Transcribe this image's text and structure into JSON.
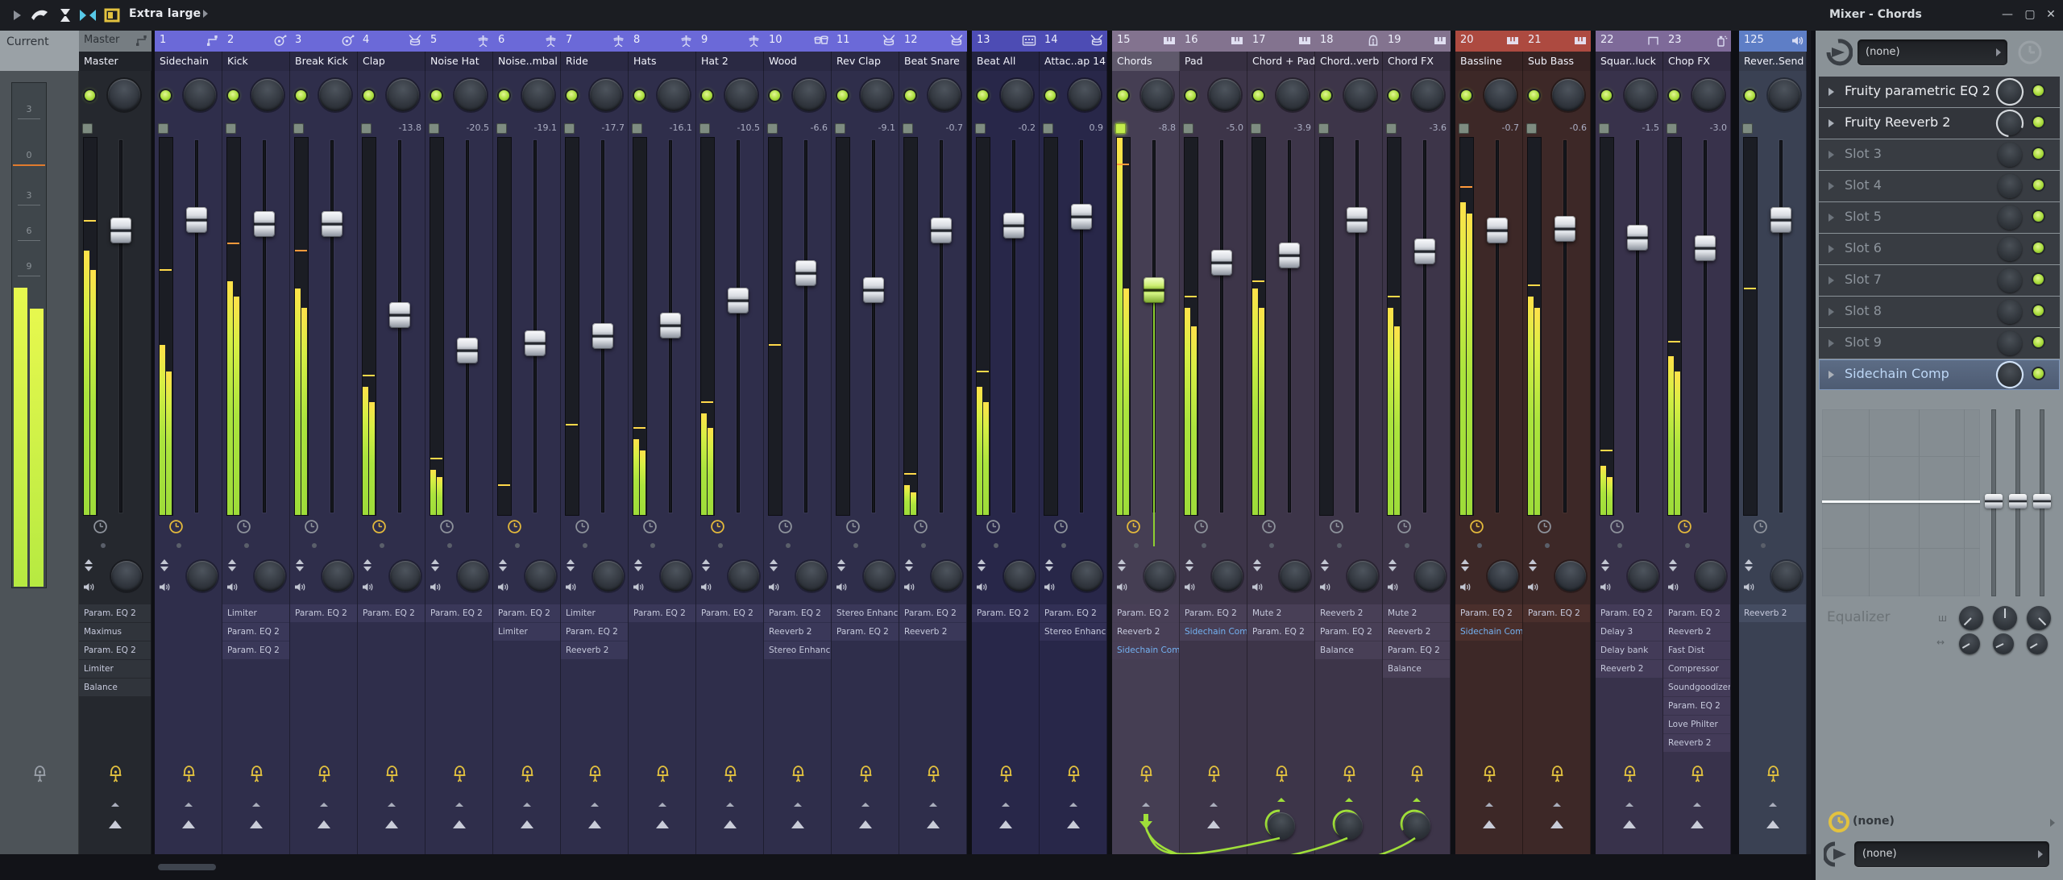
{
  "window": {
    "title": "Mixer - Chords",
    "controls": [
      {
        "glyph": "—",
        "name": "minimize"
      },
      {
        "glyph": "▢",
        "name": "maximize"
      },
      {
        "glyph": "✕",
        "name": "close"
      }
    ]
  },
  "toolbar": {
    "layout_label": "Extra large",
    "icons": [
      "play-icon",
      "detached-icon",
      "autoscroll-icon",
      "focus-icon",
      "layout-color-icon"
    ]
  },
  "groups": {
    "a": {
      "header": "#6b69d8",
      "body": "#2f2e4b",
      "row": "#3a3859"
    },
    "b": {
      "header": "#4d4cb4",
      "body": "#282749",
      "row": "#323055"
    },
    "c": {
      "header": "#83738f",
      "body": "#3d3549",
      "row": "#483f56"
    },
    "d": {
      "header": "#ad4a40",
      "body": "#3d2827",
      "row": "#4a2f2c"
    },
    "e": {
      "header": "#7e6a99",
      "body": "#38324b",
      "row": "#433b58"
    },
    "f": {
      "header": "#5e7ec6",
      "body": "#3a4153",
      "row": "#454d62"
    },
    "m": {
      "header": "#767d82",
      "body": "#25282e",
      "row": "#30343b"
    }
  },
  "status_colors": {
    "meter_green": "#abe43d",
    "peak_yellow": "#ffd94a",
    "peak_orange": "#ff9a3c",
    "select_green": "#9fdf3a",
    "clock_yellow": "#e3b93c",
    "clock_gray": "#8e939c"
  },
  "current": {
    "label": "Current",
    "scale": [
      {
        "t": "3",
        "p": 5
      },
      {
        "t": "0",
        "p": 14,
        "accent": true
      },
      {
        "t": "3",
        "p": 22
      },
      {
        "t": "6",
        "p": 29
      },
      {
        "t": "9",
        "p": 36
      }
    ],
    "meter": {
      "l": 0.59,
      "r": 0.55
    }
  },
  "master": {
    "tab": "Master",
    "name": "Master",
    "db": "",
    "fader": 0.23,
    "meter": {
      "l": 0.7,
      "r": 0.65,
      "peak": 0.78,
      "peakc": "y"
    },
    "plugins": [
      {
        "n": "Param. EQ 2"
      },
      {
        "n": "Maximus"
      },
      {
        "n": "Param. EQ 2"
      },
      {
        "n": "Limiter"
      },
      {
        "n": "Balance"
      }
    ]
  },
  "tracks": [
    {
      "num": "1",
      "name": "Sidechain",
      "icon": "routing-icon",
      "group": "a",
      "gap": 4,
      "db": "",
      "fader": 0.2,
      "meter": {
        "l": 0.45,
        "r": 0.38,
        "peak": 0.65,
        "peakc": "y"
      },
      "clock": "y",
      "plugins": []
    },
    {
      "num": "2",
      "name": "Kick",
      "icon": "kick-drum-icon",
      "group": "a",
      "gap": 0,
      "db": "",
      "fader": 0.21,
      "meter": {
        "l": 0.62,
        "r": 0.58,
        "peak": 0.72,
        "peakc": "o"
      },
      "clock": "g",
      "plugins": [
        {
          "n": "Limiter"
        },
        {
          "n": "Param. EQ 2"
        },
        {
          "n": "Param. EQ 2"
        }
      ]
    },
    {
      "num": "3",
      "name": "Break Kick",
      "icon": "kick-drum-icon",
      "group": "a",
      "gap": 0,
      "db": "",
      "fader": 0.21,
      "meter": {
        "l": 0.6,
        "r": 0.55,
        "peak": 0.7,
        "peakc": "o"
      },
      "clock": "g",
      "plugins": [
        {
          "n": "Param. EQ 2"
        }
      ]
    },
    {
      "num": "4",
      "name": "Clap",
      "icon": "snare-drum-icon",
      "group": "a",
      "gap": 0,
      "db": "-13.8",
      "fader": 0.47,
      "meter": {
        "l": 0.34,
        "r": 0.3,
        "peak": 0.37,
        "peakc": "y"
      },
      "clock": "y",
      "plugins": [
        {
          "n": "Param. EQ 2"
        }
      ]
    },
    {
      "num": "5",
      "name": "Noise Hat",
      "icon": "hihat-icon",
      "group": "a",
      "gap": 0,
      "db": "-20.5",
      "fader": 0.57,
      "meter": {
        "l": 0.12,
        "r": 0.1,
        "peak": 0.15,
        "peakc": "y"
      },
      "clock": "g",
      "plugins": [
        {
          "n": "Param. EQ 2"
        }
      ]
    },
    {
      "num": "6",
      "name": "Noise..mbal",
      "icon": "hihat-icon",
      "group": "a",
      "gap": 0,
      "db": "-19.1",
      "fader": 0.55,
      "meter": {
        "l": 0,
        "r": 0,
        "peak": 0.08,
        "peakc": "y"
      },
      "clock": "y",
      "plugins": [
        {
          "n": "Param. EQ 2"
        },
        {
          "n": "Limiter"
        }
      ]
    },
    {
      "num": "7",
      "name": "Ride",
      "icon": "hihat-icon",
      "group": "a",
      "gap": 0,
      "db": "-17.7",
      "fader": 0.53,
      "meter": {
        "l": 0,
        "r": 0,
        "peak": 0.24,
        "peakc": "y"
      },
      "clock": "g",
      "plugins": [
        {
          "n": "Limiter"
        },
        {
          "n": "Param. EQ 2"
        },
        {
          "n": "Reeverb 2"
        }
      ]
    },
    {
      "num": "8",
      "name": "Hats",
      "icon": "hihat-icon",
      "group": "a",
      "gap": 0,
      "db": "-16.1",
      "fader": 0.5,
      "meter": {
        "l": 0.2,
        "r": 0.17,
        "peak": 0.23,
        "peakc": "y"
      },
      "clock": "g",
      "plugins": [
        {
          "n": "Param. EQ 2"
        }
      ]
    },
    {
      "num": "9",
      "name": "Hat 2",
      "icon": "hihat-icon",
      "group": "a",
      "gap": 0,
      "db": "-10.5",
      "fader": 0.43,
      "meter": {
        "l": 0.27,
        "r": 0.23,
        "peak": 0.3,
        "peakc": "y"
      },
      "clock": "y",
      "plugins": [
        {
          "n": "Param. EQ 2"
        }
      ]
    },
    {
      "num": "10",
      "name": "Wood",
      "icon": "bongo-icon",
      "group": "a",
      "gap": 0,
      "db": "-6.6",
      "fader": 0.35,
      "meter": {
        "l": 0,
        "r": 0,
        "peak": 0.45,
        "peakc": "y"
      },
      "clock": "g",
      "plugins": [
        {
          "n": "Param. EQ 2"
        },
        {
          "n": "Reeverb 2"
        },
        {
          "n": "Stereo Enhancer"
        }
      ]
    },
    {
      "num": "11",
      "name": "Rev Clap",
      "icon": "snare-drum-icon",
      "group": "a",
      "gap": 0,
      "db": "-9.1",
      "fader": 0.4,
      "meter": {
        "l": 0,
        "r": 0,
        "peak": 0,
        "peakc": "y"
      },
      "clock": "g",
      "plugins": [
        {
          "n": "Stereo Enhancer"
        },
        {
          "n": "Param. EQ 2"
        }
      ]
    },
    {
      "num": "12",
      "name": "Beat Snare",
      "icon": "snare-drum-icon",
      "group": "a",
      "gap": 0,
      "db": "-0.7",
      "fader": 0.23,
      "meter": {
        "l": 0.08,
        "r": 0.06,
        "peak": 0.11,
        "peakc": "y"
      },
      "clock": "g",
      "plugins": [
        {
          "n": "Param. EQ 2"
        },
        {
          "n": "Reeverb 2"
        }
      ]
    },
    {
      "num": "13",
      "name": "Beat All",
      "icon": "drum-machine-icon",
      "group": "b",
      "gap": 6,
      "db": "-0.2",
      "fader": 0.215,
      "meter": {
        "l": 0.34,
        "r": 0.3,
        "peak": 0.38,
        "peakc": "y"
      },
      "clock": "g",
      "plugins": [
        {
          "n": "Param. EQ 2"
        }
      ]
    },
    {
      "num": "14",
      "name": "Attac..ap 14",
      "icon": "snare-drum-icon",
      "group": "b",
      "gap": 0,
      "db": "0.9",
      "fader": 0.19,
      "meter": {
        "l": 0,
        "r": 0,
        "peak": 0,
        "peakc": "y"
      },
      "clock": "g",
      "plugins": [
        {
          "n": "Param. EQ 2"
        },
        {
          "n": "Stereo Enhancer"
        }
      ]
    },
    {
      "num": "15",
      "name": "Chords",
      "icon": "piano-icon",
      "group": "c",
      "gap": 6,
      "db": "-8.8",
      "fader": 0.4,
      "meter": {
        "l": 1.0,
        "r": 0.6,
        "peak": 0.93,
        "peakc": "o"
      },
      "clock": "y",
      "selected": true,
      "bottom": "arrow",
      "plugins": [
        {
          "n": "Param. EQ 2"
        },
        {
          "n": "Reeverb 2"
        },
        {
          "n": "Sidechain Comp",
          "hl": true
        }
      ]
    },
    {
      "num": "16",
      "name": "Pad",
      "icon": "piano-icon",
      "group": "c",
      "gap": 0,
      "db": "-5.0",
      "fader": 0.32,
      "meter": {
        "l": 0.55,
        "r": 0.5,
        "peak": 0.58,
        "peakc": "y"
      },
      "clock": "g",
      "plugins": [
        {
          "n": "Param. EQ 2"
        },
        {
          "n": "Sidechain Comp",
          "hl": true
        }
      ]
    },
    {
      "num": "17",
      "name": "Chord + Pad",
      "icon": "piano-icon",
      "group": "c",
      "gap": 0,
      "db": "-3.9",
      "fader": 0.3,
      "meter": {
        "l": 0.6,
        "r": 0.55,
        "peak": 0.62,
        "peakc": "y"
      },
      "clock": "g",
      "bottom": "send",
      "plugins": [
        {
          "n": "Mute 2"
        },
        {
          "n": "Param. EQ 2"
        }
      ]
    },
    {
      "num": "18",
      "name": "Chord..verb",
      "icon": "reverb-icon",
      "group": "c",
      "gap": 0,
      "db": "",
      "fader": 0.2,
      "meter": {
        "l": 0,
        "r": 0,
        "peak": 0,
        "peakc": "y"
      },
      "clock": "g",
      "bottom": "send",
      "plugins": [
        {
          "n": "Reeverb 2"
        },
        {
          "n": "Param. EQ 2"
        },
        {
          "n": "Balance"
        }
      ]
    },
    {
      "num": "19",
      "name": "Chord FX",
      "icon": "piano-icon",
      "group": "c",
      "gap": 0,
      "db": "-3.6",
      "fader": 0.29,
      "meter": {
        "l": 0.55,
        "r": 0.5,
        "peak": 0.58,
        "peakc": "y"
      },
      "clock": "g",
      "bottom": "send",
      "plugins": [
        {
          "n": "Mute 2"
        },
        {
          "n": "Reeverb 2"
        },
        {
          "n": "Param. EQ 2"
        },
        {
          "n": "Balance"
        }
      ]
    },
    {
      "num": "20",
      "name": "Bassline",
      "icon": "piano-icon",
      "group": "d",
      "gap": 6,
      "db": "-0.7",
      "fader": 0.23,
      "meter": {
        "l": 0.83,
        "r": 0.8,
        "peak": 0.87,
        "peakc": "o"
      },
      "clock": "y",
      "plugins": [
        {
          "n": "Param. EQ 2"
        },
        {
          "n": "Sidechain Comp",
          "hl": true
        }
      ]
    },
    {
      "num": "21",
      "name": "Sub Bass",
      "icon": "piano-icon",
      "group": "d",
      "gap": 0,
      "db": "-0.6",
      "fader": 0.225,
      "meter": {
        "l": 0.58,
        "r": 0.55,
        "peak": 0.61,
        "peakc": "y"
      },
      "clock": "g",
      "plugins": [
        {
          "n": "Param. EQ 2"
        }
      ]
    },
    {
      "num": "22",
      "name": "Squar..luck",
      "icon": "square-wave-icon",
      "group": "e",
      "gap": 6,
      "db": "-1.5",
      "fader": 0.25,
      "meter": {
        "l": 0.13,
        "r": 0.1,
        "peak": 0.17,
        "peakc": "y"
      },
      "clock": "g",
      "plugins": [
        {
          "n": "Param. EQ 2"
        },
        {
          "n": "Delay 3"
        },
        {
          "n": "Delay bank"
        },
        {
          "n": "Reeverb 2"
        }
      ]
    },
    {
      "num": "23",
      "name": "Chop FX",
      "icon": "spray-icon",
      "group": "e",
      "gap": 0,
      "db": "-3.0",
      "fader": 0.28,
      "meter": {
        "l": 0.42,
        "r": 0.38,
        "peak": 0.46,
        "peakc": "y"
      },
      "clock": "y",
      "plugins": [
        {
          "n": "Param. EQ 2"
        },
        {
          "n": "Reeverb 2"
        },
        {
          "n": "Fast Dist"
        },
        {
          "n": "Compressor"
        },
        {
          "n": "Soundgoodizer"
        },
        {
          "n": "Param. EQ 2"
        },
        {
          "n": "Love Philter"
        },
        {
          "n": "Reeverb 2"
        }
      ]
    },
    {
      "num": "125",
      "name": "Rever..Send",
      "icon": "speaker-icon",
      "group": "f",
      "gap": 10,
      "db": "",
      "fader": 0.2,
      "meter": {
        "l": 0,
        "r": 0,
        "peak": 0.6,
        "peakc": "y"
      },
      "clock": "g",
      "plugins": [
        {
          "n": "Reeverb 2"
        }
      ]
    }
  ],
  "panel": {
    "input_value": "(none)",
    "slots": [
      {
        "label": "Fruity parametric EQ 2",
        "state": "used",
        "ring": "full"
      },
      {
        "label": "Fruity Reeverb 2",
        "state": "used",
        "ring": "arc"
      },
      {
        "label": "Slot 3",
        "state": "empty"
      },
      {
        "label": "Slot 4",
        "state": "empty"
      },
      {
        "label": "Slot 5",
        "state": "empty"
      },
      {
        "label": "Slot 6",
        "state": "empty"
      },
      {
        "label": "Slot 7",
        "state": "empty"
      },
      {
        "label": "Slot 8",
        "state": "empty"
      },
      {
        "label": "Slot 9",
        "state": "empty"
      },
      {
        "label": "Sidechain Comp",
        "state": "selected",
        "ring": "full-blue"
      }
    ],
    "equalizer_label": "Equalizer",
    "eq_knob_angles": [
      [
        -135,
        0,
        135
      ],
      [
        -120,
        -115,
        -120
      ]
    ],
    "time_value": "(none)",
    "output_value": "(none)"
  }
}
